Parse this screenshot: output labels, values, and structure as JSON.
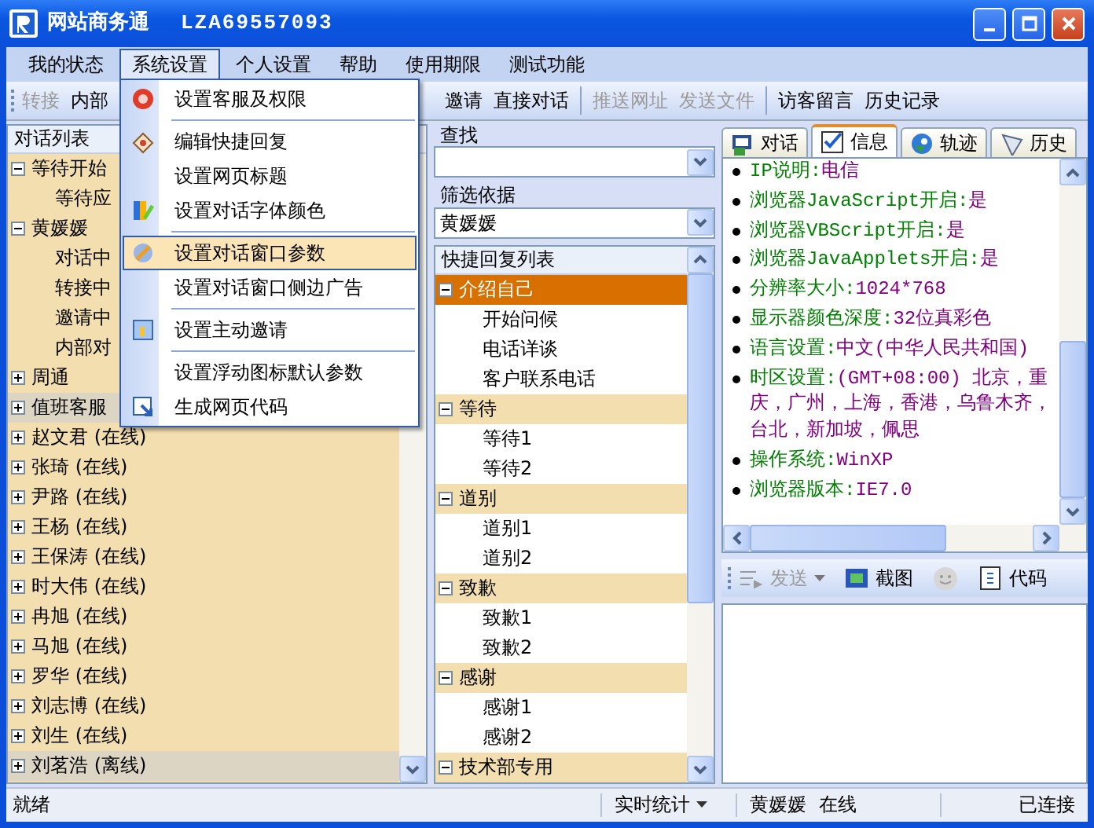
{
  "window": {
    "title": "网站商务通",
    "subtitle": "LZA69557093"
  },
  "menu": [
    {
      "label": "我的状态",
      "selected": false
    },
    {
      "label": "系统设置",
      "selected": true
    },
    {
      "label": "个人设置",
      "selected": false
    },
    {
      "label": "帮助",
      "selected": false
    },
    {
      "label": "使用期限",
      "selected": false
    },
    {
      "label": "测试功能",
      "selected": false
    }
  ],
  "toolbar": {
    "left": [
      {
        "kind": "button",
        "label": "转接",
        "disabled": true
      },
      {
        "kind": "button",
        "label": "内部",
        "disabled": false
      }
    ],
    "right": [
      {
        "kind": "button",
        "label": "邀请",
        "disabled": false
      },
      {
        "kind": "button",
        "label": "直接对话",
        "disabled": false
      },
      {
        "kind": "separator"
      },
      {
        "kind": "button",
        "label": "推送网址",
        "disabled": true
      },
      {
        "kind": "button",
        "label": "发送文件",
        "disabled": true
      },
      {
        "kind": "separator"
      },
      {
        "kind": "button",
        "label": "访客留言",
        "disabled": false
      },
      {
        "kind": "button",
        "label": "历史记录",
        "disabled": false
      }
    ]
  },
  "dropdown": [
    {
      "kind": "item",
      "label": "设置客服及权限",
      "selected": false
    },
    {
      "kind": "separator"
    },
    {
      "kind": "item",
      "label": "编辑快捷回复",
      "selected": false
    },
    {
      "kind": "item",
      "label": "设置网页标题",
      "selected": false
    },
    {
      "kind": "item",
      "label": "设置对话字体颜色",
      "selected": false
    },
    {
      "kind": "separator"
    },
    {
      "kind": "item",
      "label": "设置对话窗口参数",
      "selected": true
    },
    {
      "kind": "item",
      "label": "设置对话窗口侧边广告",
      "selected": false
    },
    {
      "kind": "separator"
    },
    {
      "kind": "item",
      "label": "设置主动邀请",
      "selected": false
    },
    {
      "kind": "separator"
    },
    {
      "kind": "item",
      "label": "设置浮动图标默认参数",
      "selected": false
    },
    {
      "kind": "item",
      "label": "生成网页代码",
      "selected": false
    }
  ],
  "conversation_list": {
    "title": "对话列表",
    "nodes": [
      {
        "label": "等待开始",
        "expanded": true,
        "shaded": false,
        "children": [
          {
            "label": "等待应"
          }
        ]
      },
      {
        "label": "黄媛媛",
        "expanded": true,
        "shaded": false,
        "children": [
          {
            "label": "对话中"
          },
          {
            "label": "转接中"
          },
          {
            "label": "邀请中"
          },
          {
            "label": "内部对"
          }
        ]
      },
      {
        "label": "周通",
        "expanded": false,
        "shaded": false
      },
      {
        "label": "值班客服",
        "expanded": false,
        "shaded": true
      },
      {
        "label": "赵文君 (在线)",
        "expanded": false,
        "shaded": false
      },
      {
        "label": "张琦 (在线)",
        "expanded": false,
        "shaded": false
      },
      {
        "label": "尹路 (在线)",
        "expanded": false,
        "shaded": false
      },
      {
        "label": "王杨 (在线)",
        "expanded": false,
        "shaded": false
      },
      {
        "label": "王保涛 (在线)",
        "expanded": false,
        "shaded": false
      },
      {
        "label": "时大伟 (在线)",
        "expanded": false,
        "shaded": false
      },
      {
        "label": "冉旭 (在线)",
        "expanded": false,
        "shaded": false
      },
      {
        "label": "马旭 (在线)",
        "expanded": false,
        "shaded": false
      },
      {
        "label": "罗华 (在线)",
        "expanded": false,
        "shaded": false
      },
      {
        "label": "刘志博 (在线)",
        "expanded": false,
        "shaded": false
      },
      {
        "label": "刘生 (在线)",
        "expanded": false,
        "shaded": false
      },
      {
        "label": "刘茗浩 (离线)",
        "expanded": false,
        "shaded": true
      }
    ]
  },
  "search": {
    "label": "查找"
  },
  "filter": {
    "label": "筛选依据",
    "value": "黄媛媛"
  },
  "quick_replies": {
    "title": "快捷回复列表",
    "groups": [
      {
        "label": "介绍自己",
        "expanded": true,
        "selected": true,
        "children": [
          {
            "label": "开始问候"
          },
          {
            "label": "电话详谈"
          },
          {
            "label": "客户联系电话"
          }
        ]
      },
      {
        "label": "等待",
        "expanded": true,
        "selected": false,
        "children": [
          {
            "label": "等待1"
          },
          {
            "label": "等待2"
          }
        ]
      },
      {
        "label": "道别",
        "expanded": true,
        "selected": false,
        "children": [
          {
            "label": "道别1"
          },
          {
            "label": "道别2"
          }
        ]
      },
      {
        "label": "致歉",
        "expanded": true,
        "selected": false,
        "children": [
          {
            "label": "致歉1"
          },
          {
            "label": "致歉2"
          }
        ]
      },
      {
        "label": "感谢",
        "expanded": true,
        "selected": false,
        "children": [
          {
            "label": "感谢1"
          },
          {
            "label": "感谢2"
          }
        ]
      },
      {
        "label": "技术部专用",
        "expanded": true,
        "selected": false
      }
    ]
  },
  "tabs": [
    {
      "label": "对话",
      "selected": false
    },
    {
      "label": "信息",
      "selected": true
    },
    {
      "label": "轨迹",
      "selected": false
    },
    {
      "label": "历史",
      "selected": false
    }
  ],
  "visitor_info": [
    {
      "label": "IP说明:",
      "value": "电信"
    },
    {
      "label": "浏览器JavaScript开启:",
      "value": "是"
    },
    {
      "label": "浏览器VBScript开启:",
      "value": "是"
    },
    {
      "label": "浏览器JavaApplets开启:",
      "value": "是"
    },
    {
      "label": "分辨率大小:",
      "value": "1024*768"
    },
    {
      "label": "显示器颜色深度:",
      "value": "32位真彩色"
    },
    {
      "label": "语言设置:",
      "value": "中文(中华人民共和国)"
    },
    {
      "label": "时区设置:",
      "value": "(GMT+08:00) 北京，重庆，广州，上海，香港，乌鲁木齐，台北，新加坡，佩思"
    },
    {
      "label": "操作系统:",
      "value": "WinXP"
    },
    {
      "label": "浏览器版本:",
      "value": "IE7.0"
    }
  ],
  "input_toolbar": [
    {
      "kind": "send",
      "label": "发送",
      "disabled": true
    },
    {
      "kind": "button",
      "label": "截图",
      "disabled": false
    },
    {
      "kind": "emoji",
      "disabled": true
    },
    {
      "kind": "button",
      "label": "代码",
      "disabled": false
    }
  ],
  "status_bar": {
    "text": "就绪",
    "stats": "实时统计",
    "user": "黄媛媛",
    "presence": "在线",
    "connection": "已连接"
  }
}
